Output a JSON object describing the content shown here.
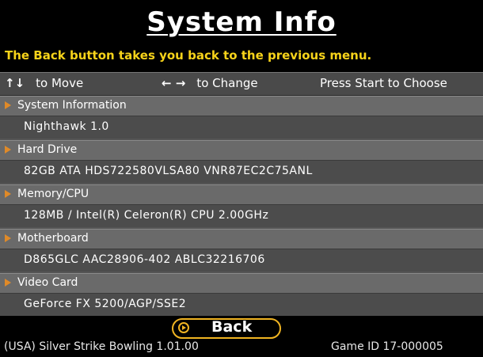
{
  "title": "System Info",
  "help_text": "The Back button takes you back to the previous menu.",
  "hints": {
    "move_arrows": "↑↓",
    "move_label": "to Move",
    "change_arrows": "← →",
    "change_label": "to Change",
    "choose_label": "Press Start to Choose"
  },
  "sections": [
    {
      "label": "System Information",
      "value": "Nighthawk 1.0"
    },
    {
      "label": "Hard Drive",
      "value": "82GB ATA HDS722580VLSA80 VNR87EC2C75ANL"
    },
    {
      "label": "Memory/CPU",
      "value": "128MB / Intel(R) Celeron(R) CPU 2.00GHz"
    },
    {
      "label": "Motherboard",
      "value": "D865GLC AAC28906-402 ABLC32216706"
    },
    {
      "label": "Video Card",
      "value": "GeForce FX 5200/AGP/SSE2"
    }
  ],
  "back_button": {
    "label": "Back"
  },
  "footer": {
    "game_name": "(USA) Silver Strike Bowling 1.01.00",
    "game_id": "Game ID 17-000005"
  },
  "colors": {
    "accent": "#f7d31a",
    "button_outline": "#f0b422",
    "triangle": "#e08a28"
  }
}
